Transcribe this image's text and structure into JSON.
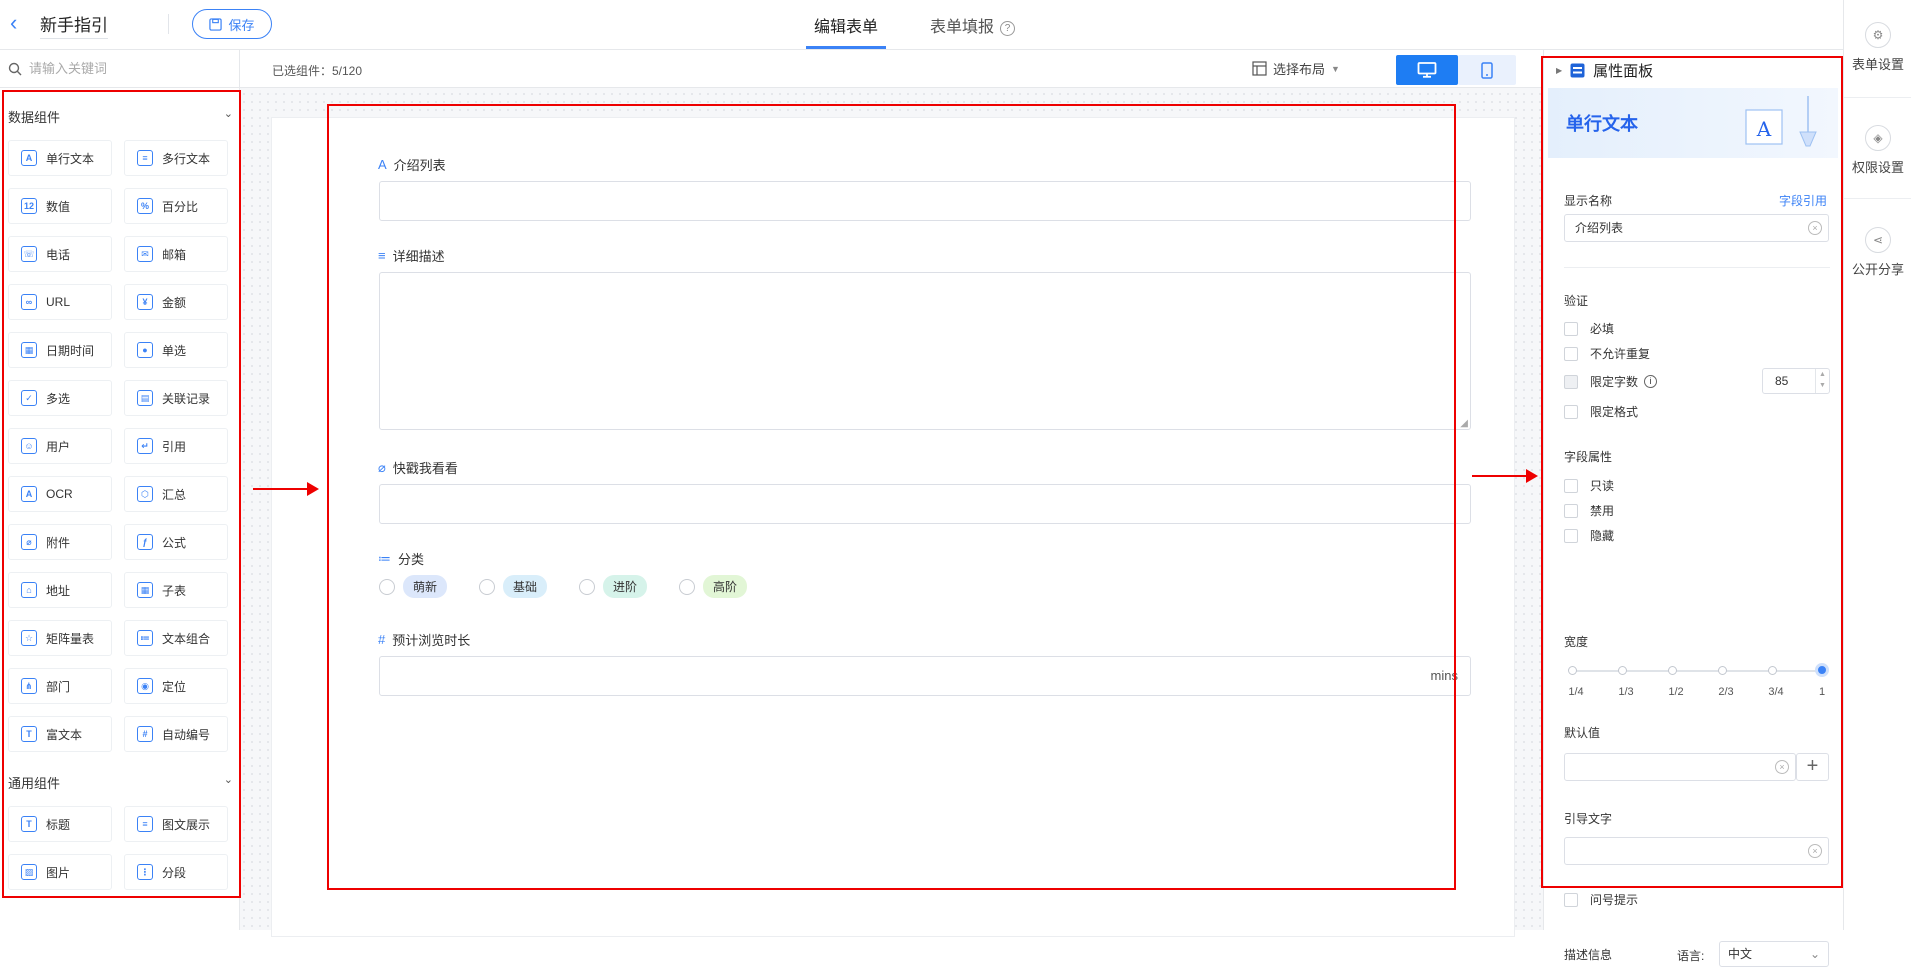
{
  "header": {
    "back_icon": "‹",
    "app_name": "新手指引",
    "save_label": "保存",
    "tabs": [
      {
        "label": "编辑表单"
      },
      {
        "label": "表单填报"
      }
    ],
    "help_icon": "?"
  },
  "rail": {
    "items": [
      {
        "label": "表单设置"
      },
      {
        "label": "权限设置"
      },
      {
        "label": "公开分享"
      }
    ]
  },
  "left_panel": {
    "search_placeholder": "请输入关键词",
    "groups": [
      {
        "title": "数据组件",
        "items": [
          {
            "label": "单行文本",
            "icon": "A"
          },
          {
            "label": "多行文本",
            "icon": "≡"
          },
          {
            "label": "数值",
            "icon": "12"
          },
          {
            "label": "百分比",
            "icon": "%"
          },
          {
            "label": "电话",
            "icon": "☏"
          },
          {
            "label": "邮箱",
            "icon": "✉"
          },
          {
            "label": "URL",
            "icon": "∞"
          },
          {
            "label": "金额",
            "icon": "¥"
          },
          {
            "label": "日期时间",
            "icon": "▦"
          },
          {
            "label": "单选",
            "icon": "●"
          },
          {
            "label": "多选",
            "icon": "✓"
          },
          {
            "label": "关联记录",
            "icon": "▤"
          },
          {
            "label": "用户",
            "icon": "☺"
          },
          {
            "label": "引用",
            "icon": "↵"
          },
          {
            "label": "OCR",
            "icon": "A"
          },
          {
            "label": "汇总",
            "icon": "⬡"
          },
          {
            "label": "附件",
            "icon": "⌀"
          },
          {
            "label": "公式",
            "icon": "ƒ"
          },
          {
            "label": "地址",
            "icon": "⌂"
          },
          {
            "label": "子表",
            "icon": "▦"
          },
          {
            "label": "矩阵量表",
            "icon": "☆"
          },
          {
            "label": "文本组合",
            "icon": "≔"
          },
          {
            "label": "部门",
            "icon": "⋔"
          },
          {
            "label": "定位",
            "icon": "◉"
          },
          {
            "label": "富文本",
            "icon": "T"
          },
          {
            "label": "自动编号",
            "icon": "#"
          }
        ]
      },
      {
        "title": "通用组件",
        "items": [
          {
            "label": "标题",
            "icon": "T"
          },
          {
            "label": "图文展示",
            "icon": "≡"
          },
          {
            "label": "图片",
            "icon": "▨"
          },
          {
            "label": "分段",
            "icon": "⋮"
          }
        ]
      }
    ]
  },
  "middle": {
    "selected_count": "已选组件：5/120",
    "layout_select": "选择布局",
    "fields": [
      {
        "label": "介绍列表",
        "icon": "A"
      },
      {
        "label": "详细描述",
        "icon": "≡"
      },
      {
        "label": "快戳我看看",
        "icon": "⌀"
      },
      {
        "label": "分类",
        "icon": "≔",
        "options": [
          {
            "label": "萌新",
            "color": "#dce7fb"
          },
          {
            "label": "基础",
            "color": "#d9eefa"
          },
          {
            "label": "进阶",
            "color": "#d6f3ea"
          },
          {
            "label": "高阶",
            "color": "#e2f6d6"
          }
        ]
      },
      {
        "label": "预计浏览时长",
        "icon": "#",
        "suffix": "mins"
      }
    ]
  },
  "right_panel": {
    "title": "属性面板",
    "banner_title": "单行文本",
    "display_name_label": "显示名称",
    "field_ref_link": "字段引用",
    "display_name_value": "介绍列表",
    "validation_label": "验证",
    "validation_items": [
      {
        "label": "必填"
      },
      {
        "label": "不允许重复"
      },
      {
        "label": "限定字数",
        "value": "85"
      },
      {
        "label": "限定格式"
      }
    ],
    "field_attr_label": "字段属性",
    "field_attr_items": [
      {
        "label": "只读"
      },
      {
        "label": "禁用"
      },
      {
        "label": "隐藏"
      }
    ],
    "width_label": "宽度",
    "width_ticks": [
      "1/4",
      "1/3",
      "1/2",
      "2/3",
      "3/4",
      "1"
    ],
    "width_selected": "1",
    "default_label": "默认值",
    "guide_label": "引导文字",
    "tooltip_label": "问号提示",
    "desc_label": "描述信息",
    "lang_label": "语言:",
    "lang_value": "中文"
  },
  "colors": {
    "accent": "#3b82f6",
    "annotation": "#e00000"
  }
}
